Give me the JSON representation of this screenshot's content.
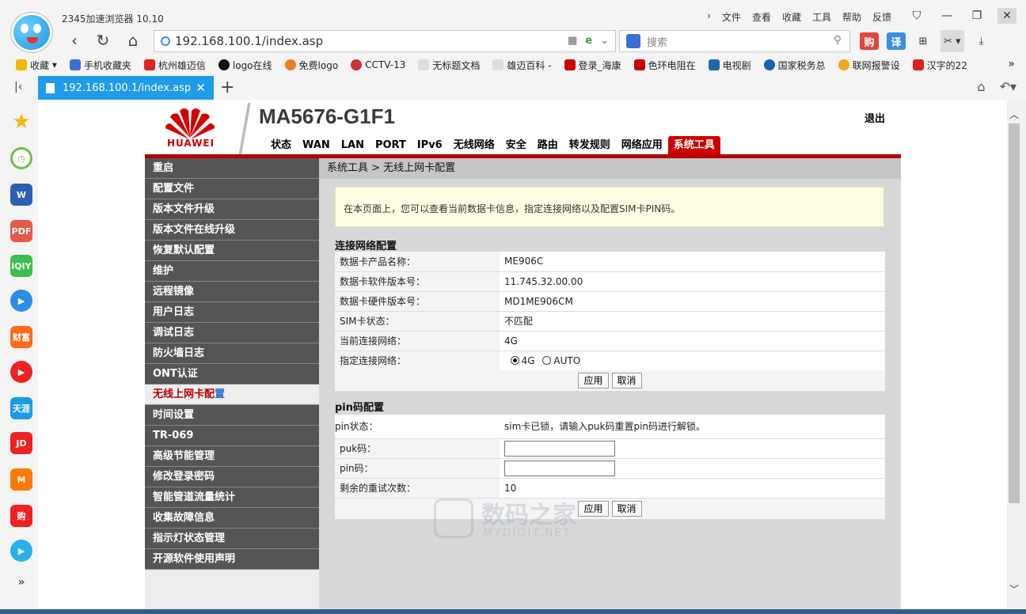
{
  "browser": {
    "title": "2345加速浏览器 10.10",
    "menu": [
      "文件",
      "查看",
      "收藏",
      "工具",
      "帮助",
      "反馈"
    ],
    "address": "192.168.100.1/index.asp",
    "search_placeholder": "搜索",
    "bookmarks": [
      "收藏",
      "手机收藏夹",
      "杭州雄迈信",
      "logo在线",
      "免费logo",
      "CCTV-13",
      "无标题文档",
      "雄迈百科 -",
      "登录_海康",
      "色环电阻在",
      "电视剧",
      "国家税务总",
      "联网报警设",
      "汉字的22"
    ],
    "tab_title": "192.168.100.1/index.asp",
    "sidebar_icons": [
      "star-icon",
      "clock-icon",
      "word-icon",
      "pdf-icon",
      "iqiyi-icon",
      "video-icon",
      "finance-icon",
      "play-icon",
      "tianya-icon",
      "jd-icon",
      "mango-icon",
      "shop-icon",
      "tencent-video-icon"
    ]
  },
  "router": {
    "brand": "HUAWEI",
    "model": "MA5676-G1F1",
    "logout": "退出",
    "nav": [
      "状态",
      "WAN",
      "LAN",
      "PORT",
      "IPv6",
      "无线网络",
      "安全",
      "路由",
      "转发规则",
      "网络应用",
      "系统工具"
    ],
    "active_nav": "系统工具",
    "side_nav": [
      "重启",
      "配置文件",
      "版本文件升级",
      "版本文件在线升级",
      "恢复默认配置",
      "维护",
      "远程镜像",
      "用户日志",
      "调试日志",
      "防火墙日志",
      "ONT认证",
      "无线上网卡配",
      "时间设置",
      "TR-069",
      "高级节能管理",
      "修改登录密码",
      "智能管道流量统计",
      "收集故障信息",
      "指示灯状态管理",
      "开源软件使用声明"
    ],
    "side_nav_current_tail": "置",
    "breadcrumb": "系统工具 > 无线上网卡配置",
    "notice": "在本页面上，您可以查看当前数据卡信息，指定连接网络以及配置SIM卡PIN码。",
    "conn_section": "连接网络配置",
    "conn_rows": [
      {
        "k": "数据卡产品名称：",
        "v": "ME906C"
      },
      {
        "k": "数据卡软件版本号：",
        "v": "11.745.32.00.00"
      },
      {
        "k": "数据卡硬件版本号：",
        "v": "MD1ME906CM"
      },
      {
        "k": "SIM卡状态：",
        "v": "不匹配"
      },
      {
        "k": "当前连接网络：",
        "v": "4G"
      }
    ],
    "net_label": "指定连接网络：",
    "net_options": [
      "4G",
      "AUTO"
    ],
    "net_selected": "4G",
    "apply": "应用",
    "cancel": "取消",
    "pin_section": "pin码配置",
    "pin_status_label": "pin状态：",
    "pin_status": "sim卡已锁，请输入puk码重置pin码进行解锁。",
    "puk_label": "puk码：",
    "pin_label": "pin码：",
    "retries_label": "剩余的重试次数：",
    "retries": "10"
  },
  "watermark": {
    "cn": "数码之家",
    "en": "MYDIGIT.NET"
  }
}
